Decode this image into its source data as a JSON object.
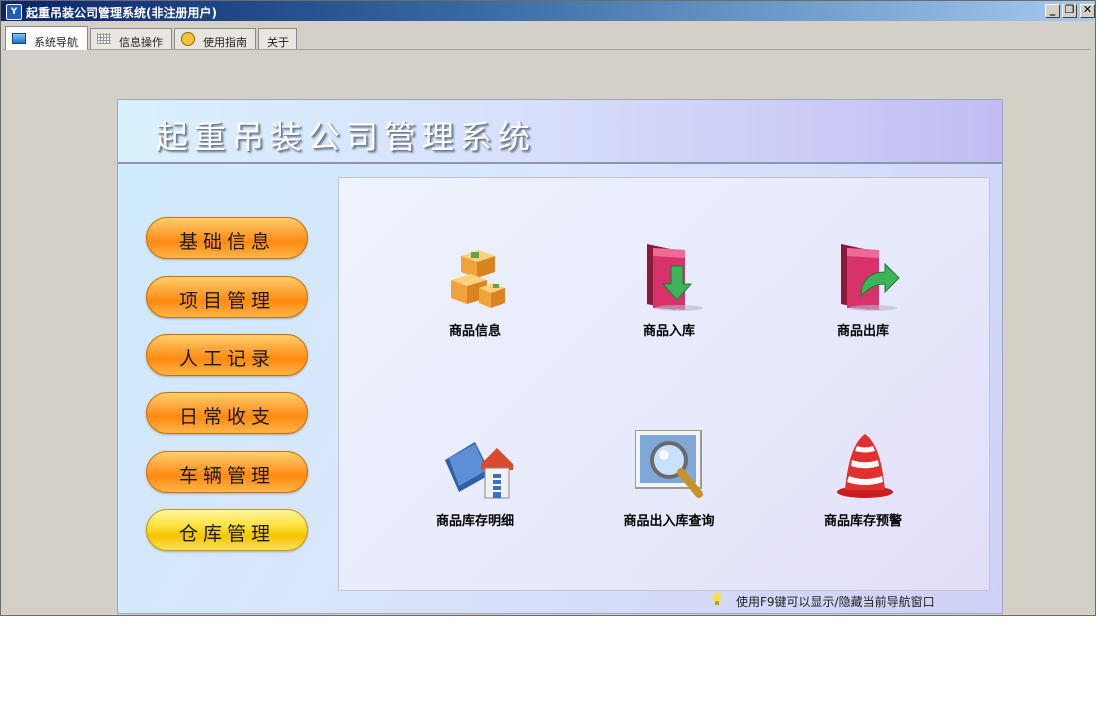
{
  "window": {
    "title": "起重吊装公司管理系统(非注册用户)"
  },
  "controls": {
    "min": "_",
    "restore": "❐",
    "close": "✕"
  },
  "tabs": [
    {
      "label": "系统导航",
      "icon": "monitor-icon",
      "active": true
    },
    {
      "label": "信息操作",
      "icon": "grid-icon",
      "active": false
    },
    {
      "label": "使用指南",
      "icon": "help-icon",
      "active": false
    },
    {
      "label": "关于",
      "icon": "",
      "active": false
    }
  ],
  "banner": {
    "title": "起重吊装公司管理系统"
  },
  "menu": [
    {
      "label": "基础信息"
    },
    {
      "label": "项目管理"
    },
    {
      "label": "人工记录"
    },
    {
      "label": "日常收支"
    },
    {
      "label": "车辆管理"
    },
    {
      "label": "仓库管理",
      "selected": true
    }
  ],
  "items": [
    {
      "label": "商品信息",
      "icon": "boxes-icon"
    },
    {
      "label": "商品入库",
      "icon": "folder-in-icon"
    },
    {
      "label": "商品出库",
      "icon": "folder-out-icon"
    },
    {
      "label": "商品库存明细",
      "icon": "warehouse-book-icon"
    },
    {
      "label": "商品出入库查询",
      "icon": "magnifier-icon"
    },
    {
      "label": "商品库存预警",
      "icon": "alarm-bell-icon"
    }
  ],
  "hint": {
    "text": "使用F9键可以显示/隐藏当前导航窗口"
  }
}
